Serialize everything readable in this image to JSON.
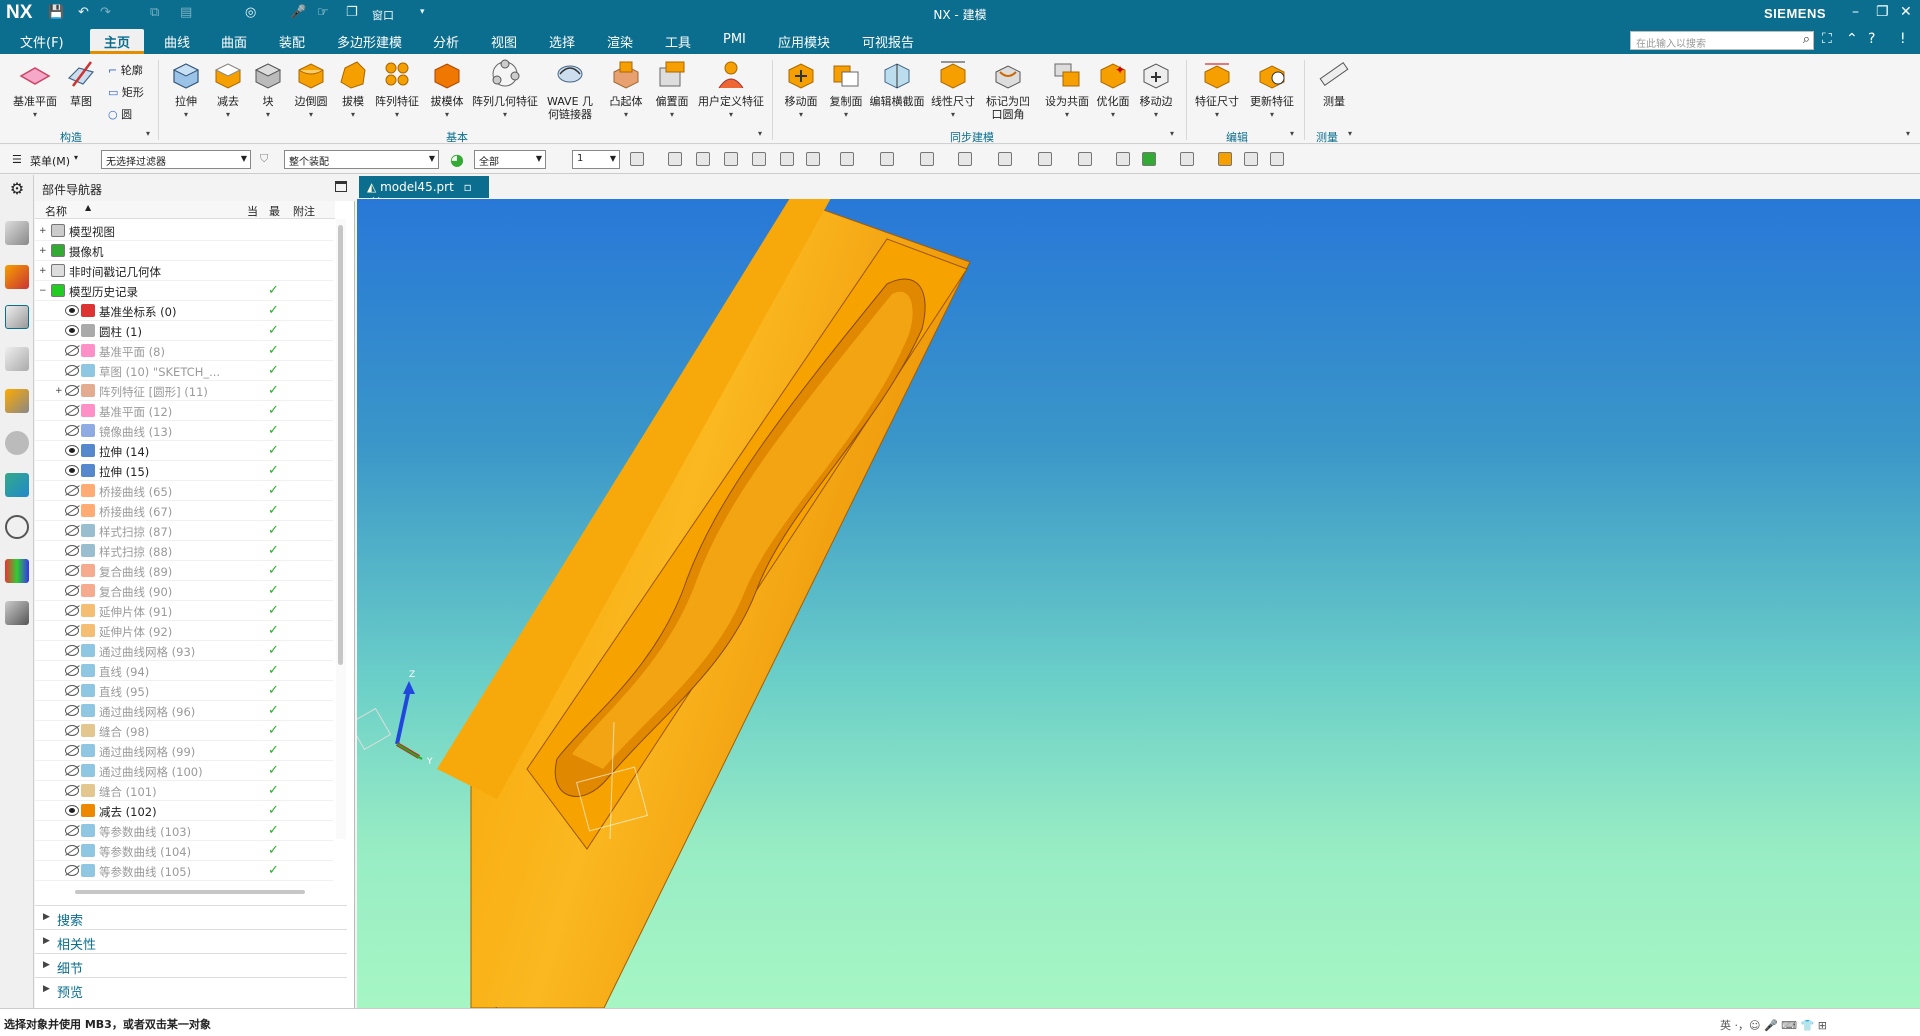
{
  "titlebar": {
    "logo": "NX",
    "title": "NX - 建模",
    "brand": "SIEMENS",
    "window_label": "窗口"
  },
  "menu": {
    "file": "文件(F)",
    "tabs": [
      "主页",
      "曲线",
      "曲面",
      "装配",
      "多边形建模",
      "分析",
      "视图",
      "选择",
      "渲染",
      "工具",
      "PMI",
      "应用模块",
      "可视报告"
    ],
    "search_placeholder": "在此输入以搜索"
  },
  "ribbon": {
    "construct": {
      "datum_plane": "基准平面",
      "sketch": "草图",
      "contour": "轮廓",
      "rectangle": "矩形",
      "circle": "圆",
      "label": "构造"
    },
    "basic": {
      "buttons": [
        "拉伸",
        "减去",
        "块",
        "边倒圆",
        "拔模",
        "阵列特征",
        "拔模体",
        "阵列几何特征",
        "WAVE 几\n何链接器",
        "凸起体",
        "偏置面",
        "用户定义特征"
      ],
      "label": "基本"
    },
    "sync": {
      "buttons": [
        "移动面",
        "复制面",
        "编辑横截面",
        "线性尺寸",
        "标记为凹\n口圆角",
        "设为共面",
        "优化面",
        "移动边"
      ],
      "label": "同步建模"
    },
    "edit": {
      "buttons": [
        "特征尺寸",
        "更新特征"
      ],
      "label": "编辑"
    },
    "measure": {
      "buttons": [
        "测量"
      ],
      "label": "测量"
    }
  },
  "toolbar2": {
    "menu": "菜单(M)",
    "filter": "无选择过滤器",
    "assembly": "整个装配",
    "scope": "全部",
    "layer": "1"
  },
  "navigator": {
    "title": "部件导航器",
    "columns": {
      "name": "名称",
      "current": "当",
      "latest": "最",
      "note": "附注"
    },
    "groups": [
      "模型视图",
      "摄像机",
      "非时间戳记几何体",
      "模型历史记录"
    ],
    "features": [
      {
        "label": "基准坐标系 (0)",
        "on": true,
        "color": "#d33"
      },
      {
        "label": "圆柱 (1)",
        "on": true,
        "color": "#aaa"
      },
      {
        "label": "基准平面 (8)",
        "on": false,
        "color": "#f39"
      },
      {
        "label": "草图 (10) \"SKETCH_...",
        "on": false,
        "color": "#39c"
      },
      {
        "label": "阵列特征 [圆形] (11)",
        "on": false,
        "color": "#c63",
        "plus": true
      },
      {
        "label": "基准平面 (12)",
        "on": false,
        "color": "#f39"
      },
      {
        "label": "镜像曲线 (13)",
        "on": false,
        "color": "#36c"
      },
      {
        "label": "拉伸 (14)",
        "on": true,
        "color": "#58c"
      },
      {
        "label": "拉伸 (15)",
        "on": true,
        "color": "#58c"
      },
      {
        "label": "桥接曲线 (65)",
        "on": false,
        "color": "#f60"
      },
      {
        "label": "桥接曲线 (67)",
        "on": false,
        "color": "#f60"
      },
      {
        "label": "样式扫掠 (87)",
        "on": false,
        "color": "#48a"
      },
      {
        "label": "样式扫掠 (88)",
        "on": false,
        "color": "#48a"
      },
      {
        "label": "复合曲线 (89)",
        "on": false,
        "color": "#e63"
      },
      {
        "label": "复合曲线 (90)",
        "on": false,
        "color": "#e63"
      },
      {
        "label": "延伸片体 (91)",
        "on": false,
        "color": "#e80"
      },
      {
        "label": "延伸片体 (92)",
        "on": false,
        "color": "#e80"
      },
      {
        "label": "通过曲线网格 (93)",
        "on": false,
        "color": "#39c"
      },
      {
        "label": "直线 (94)",
        "on": false,
        "color": "#39c"
      },
      {
        "label": "直线 (95)",
        "on": false,
        "color": "#39c"
      },
      {
        "label": "通过曲线网格 (96)",
        "on": false,
        "color": "#39c"
      },
      {
        "label": "缝合 (98)",
        "on": false,
        "color": "#c93"
      },
      {
        "label": "通过曲线网格 (99)",
        "on": false,
        "color": "#39c"
      },
      {
        "label": "通过曲线网格 (100)",
        "on": false,
        "color": "#39c"
      },
      {
        "label": "缝合 (101)",
        "on": false,
        "color": "#c93"
      },
      {
        "label": "减去 (102)",
        "on": true,
        "color": "#e80"
      },
      {
        "label": "等参数曲线 (103)",
        "on": false,
        "color": "#39c"
      },
      {
        "label": "等参数曲线 (104)",
        "on": false,
        "color": "#39c"
      },
      {
        "label": "等参数曲线 (105)",
        "on": false,
        "color": "#39c"
      }
    ],
    "sections": [
      "搜索",
      "相关性",
      "细节",
      "预览"
    ]
  },
  "document": {
    "tab": "model45.prt"
  },
  "status": {
    "text": "选择对象并使用 MB3，或者双击某一对象",
    "watermark": "英 ·，☺ 🎤 ⌨ 👕 ⊞"
  },
  "colors": {
    "accent": "#0b6e8f",
    "orange": "#f5a000",
    "check": "#27b227"
  }
}
